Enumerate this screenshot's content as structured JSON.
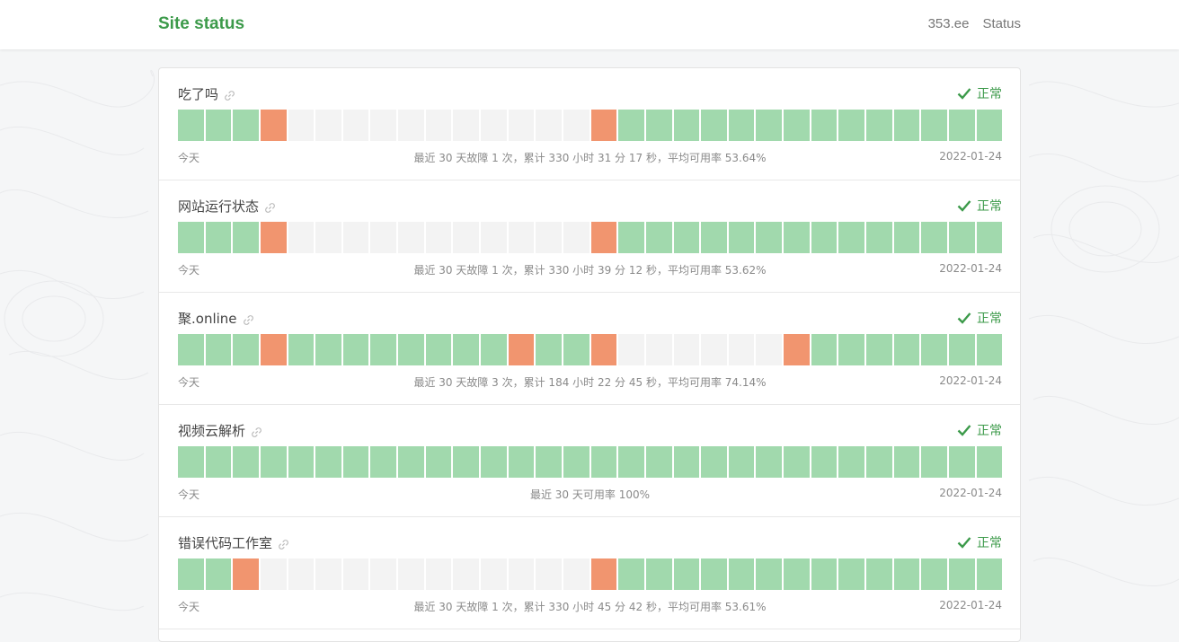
{
  "header": {
    "brand": "Site status",
    "nav": [
      "353.ee",
      "Status"
    ]
  },
  "colors": {
    "brand": "#3c9a4a",
    "up": "#a1d9ad",
    "down": "#f1956f",
    "none": "#f3f3f3"
  },
  "sites": [
    {
      "name": "吃了吗",
      "status": "正常",
      "today_label": "今天",
      "summary": "最近 30 天故障 1 次，累计 330 小时 31 分 17 秒，平均可用率 53.64%",
      "date": "2022-01-24",
      "bars": [
        "up",
        "up",
        "up",
        "down",
        "none",
        "none",
        "none",
        "none",
        "none",
        "none",
        "none",
        "none",
        "none",
        "none",
        "none",
        "down",
        "up",
        "up",
        "up",
        "up",
        "up",
        "up",
        "up",
        "up",
        "up",
        "up",
        "up",
        "up",
        "up",
        "up"
      ]
    },
    {
      "name": "网站运行状态",
      "status": "正常",
      "today_label": "今天",
      "summary": "最近 30 天故障 1 次，累计 330 小时 39 分 12 秒，平均可用率 53.62%",
      "date": "2022-01-24",
      "bars": [
        "up",
        "up",
        "up",
        "down",
        "none",
        "none",
        "none",
        "none",
        "none",
        "none",
        "none",
        "none",
        "none",
        "none",
        "none",
        "down",
        "up",
        "up",
        "up",
        "up",
        "up",
        "up",
        "up",
        "up",
        "up",
        "up",
        "up",
        "up",
        "up",
        "up"
      ]
    },
    {
      "name": "聚.online",
      "status": "正常",
      "today_label": "今天",
      "summary": "最近 30 天故障 3 次，累计 184 小时 22 分 45 秒，平均可用率 74.14%",
      "date": "2022-01-24",
      "bars": [
        "up",
        "up",
        "up",
        "down",
        "up",
        "up",
        "up",
        "up",
        "up",
        "up",
        "up",
        "up",
        "down",
        "up",
        "up",
        "down",
        "none",
        "none",
        "none",
        "none",
        "none",
        "none",
        "down",
        "up",
        "up",
        "up",
        "up",
        "up",
        "up",
        "up"
      ]
    },
    {
      "name": "视频云解析",
      "status": "正常",
      "today_label": "今天",
      "summary": "最近 30 天可用率 100%",
      "date": "2022-01-24",
      "bars": [
        "up",
        "up",
        "up",
        "up",
        "up",
        "up",
        "up",
        "up",
        "up",
        "up",
        "up",
        "up",
        "up",
        "up",
        "up",
        "up",
        "up",
        "up",
        "up",
        "up",
        "up",
        "up",
        "up",
        "up",
        "up",
        "up",
        "up",
        "up",
        "up",
        "up"
      ]
    },
    {
      "name": "错误代码工作室",
      "status": "正常",
      "today_label": "今天",
      "summary": "最近 30 天故障 1 次，累计 330 小时 45 分 42 秒，平均可用率 53.61%",
      "date": "2022-01-24",
      "bars": [
        "up",
        "up",
        "down",
        "none",
        "none",
        "none",
        "none",
        "none",
        "none",
        "none",
        "none",
        "none",
        "none",
        "none",
        "none",
        "down",
        "up",
        "up",
        "up",
        "up",
        "up",
        "up",
        "up",
        "up",
        "up",
        "up",
        "up",
        "up",
        "up",
        "up"
      ]
    }
  ]
}
